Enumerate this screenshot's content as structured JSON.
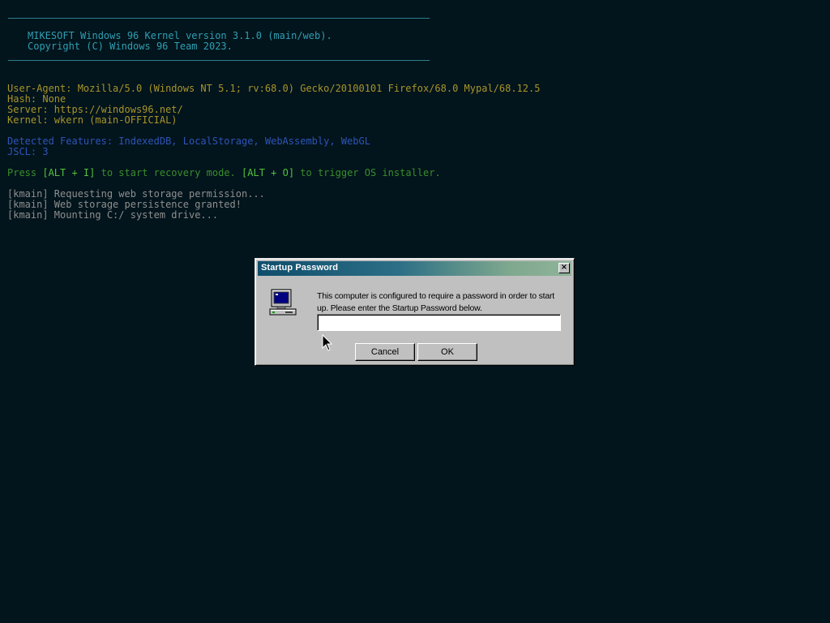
{
  "console": {
    "banner_line_1": "MIKESOFT Windows 96 Kernel version 3.1.0 (main/web).",
    "banner_line_2": "Copyright (C) Windows 96 Team 2023.",
    "user_agent": "User-Agent: Mozilla/5.0 (Windows NT 5.1; rv:68.0) Gecko/20100101 Firefox/68.0 Mypal/68.12.5",
    "hash": "Hash: None",
    "server": "Server: https://windows96.net/",
    "kernel": "Kernel: wkern (main-OFFICIAL)",
    "detected_features": "Detected Features: IndexedDB, LocalStorage, WebAssembly, WebGL",
    "jscl": "JSCL: 3",
    "recovery_prefix": "Press ",
    "recovery_key_1": "[ALT + I]",
    "recovery_middle": " to start recovery mode. ",
    "recovery_key_2": "[ALT + O]",
    "recovery_suffix": " to trigger OS installer.",
    "log": [
      "[kmain] Requesting web storage permission...",
      "[kmain] Web storage persistence granted!",
      "[kmain] Mounting C:/ system drive..."
    ]
  },
  "dialog": {
    "title": "Startup Password",
    "close_label": "×",
    "message": "This computer is configured to require a password in order to start up. Please enter the Startup Password below.",
    "password_value": "",
    "cancel_label": "Cancel",
    "ok_label": "OK",
    "icon": "computer-icon"
  },
  "colors": {
    "background": "#02141c",
    "banner": "#2f9fb2",
    "info": "#a8952a",
    "features": "#2e55b8",
    "recovery": "#3a8e2a",
    "log": "#8f8f8f"
  }
}
